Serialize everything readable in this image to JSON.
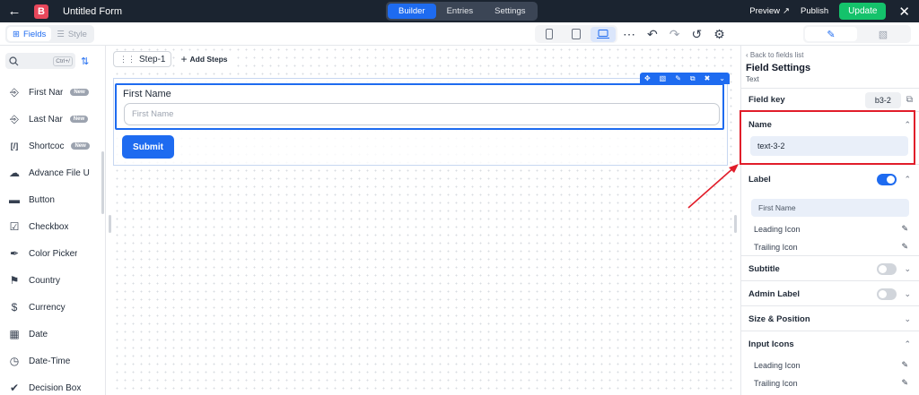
{
  "topbar": {
    "title": "Untitled Form",
    "tabs": [
      "Builder",
      "Entries",
      "Settings"
    ],
    "preview": "Preview",
    "publish": "Publish",
    "update": "Update"
  },
  "toolbar": {
    "fields_tab": "Fields",
    "style_tab": "Style"
  },
  "sidebar": {
    "search_placeholder": "",
    "shortcut": "Ctrl+/",
    "items": [
      {
        "label": "First Nar",
        "icon": "text-field-icon",
        "badge": "New"
      },
      {
        "label": "Last Nar",
        "icon": "text-field-icon",
        "badge": "New"
      },
      {
        "label": "Shortcoc",
        "icon": "shortcode-icon",
        "badge": "New"
      },
      {
        "label": "Advance File U",
        "icon": "upload-icon",
        "badge": ""
      },
      {
        "label": "Button",
        "icon": "button-icon",
        "badge": ""
      },
      {
        "label": "Checkbox",
        "icon": "checkbox-icon",
        "badge": ""
      },
      {
        "label": "Color Picker",
        "icon": "color-picker-icon",
        "badge": ""
      },
      {
        "label": "Country",
        "icon": "flag-icon",
        "badge": ""
      },
      {
        "label": "Currency",
        "icon": "dollar-icon",
        "badge": ""
      },
      {
        "label": "Date",
        "icon": "calendar-icon",
        "badge": ""
      },
      {
        "label": "Date-Time",
        "icon": "clock-icon",
        "badge": ""
      },
      {
        "label": "Decision Box",
        "icon": "check-circle-icon",
        "badge": ""
      }
    ]
  },
  "canvas": {
    "step": "Step-1",
    "add_steps": "Add Steps",
    "field_label": "First Name",
    "field_placeholder": "First Name",
    "submit": "Submit"
  },
  "panel": {
    "back": "Back to fields list",
    "title": "Field Settings",
    "subtitle": "Text",
    "field_key_label": "Field key",
    "field_key_value": "b3-2",
    "name_label": "Name",
    "name_value": "text-3-2",
    "label_label": "Label",
    "label_value": "First Name",
    "leading_icon": "Leading Icon",
    "trailing_icon": "Trailing Icon",
    "subtitle_label": "Subtitle",
    "admin_label": "Admin Label",
    "size_position": "Size & Position",
    "input_icons": "Input Icons",
    "input_leading_icon": "Leading Icon",
    "input_trailing_icon": "Trailing Icon"
  },
  "colors": {
    "accent": "#1e6bf0",
    "topbar": "#1b2430",
    "update": "#14c26b",
    "highlight": "#e11d2a"
  }
}
